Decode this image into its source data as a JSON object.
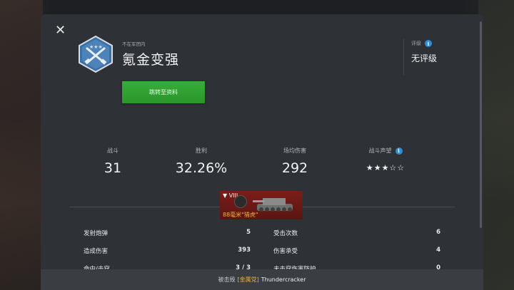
{
  "player": {
    "clan_status": "不在军团内",
    "name": "氪金变强",
    "profile_button": "跳转至资料"
  },
  "rating": {
    "label": "评级",
    "value": "无评级"
  },
  "stats": [
    {
      "label": "战斗",
      "value": "31"
    },
    {
      "label": "胜利",
      "value": "32.26%"
    },
    {
      "label": "场均伤害",
      "value": "292"
    },
    {
      "label": "战斗声望",
      "stars": "★★★☆☆",
      "stars_value": 3,
      "stars_max": 5
    }
  ],
  "tank": {
    "tier": "▼ VIII",
    "name": "88毫米\"猎虎\""
  },
  "details": [
    {
      "label": "发射炮弹",
      "value": "5"
    },
    {
      "label": "受击次数",
      "value": "6"
    },
    {
      "label": "造成伤害",
      "value": "393"
    },
    {
      "label": "伤害承受",
      "value": "4"
    },
    {
      "label": "命中/击穿",
      "value": "3 / 3"
    },
    {
      "label": "未击穿伤害防护",
      "value": "0"
    }
  ],
  "killed_by": {
    "prefix": "被击毁",
    "clan_tag": "[金属党]",
    "player": "Thundercracker"
  },
  "colors": {
    "accent_green": "#2f9f31",
    "tank_card": "#6b1a16",
    "clan_tag": "#f1b43a",
    "info_icon": "#2d8fd8"
  }
}
